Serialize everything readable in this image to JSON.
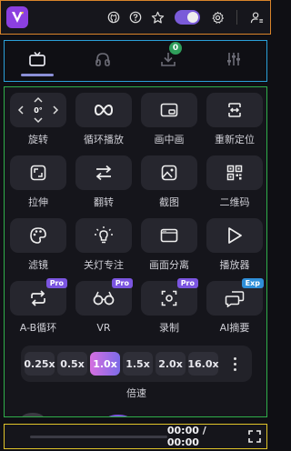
{
  "topbar": {
    "icons": [
      "logo-icon",
      "github-icon",
      "help-icon",
      "star-icon",
      "toggle",
      "gear-icon",
      "user-settings-icon"
    ],
    "toggle_on": true
  },
  "tabs": {
    "items": [
      {
        "name": "tv-icon",
        "active": true
      },
      {
        "name": "headphones-icon",
        "active": false
      },
      {
        "name": "download-icon",
        "active": false,
        "badge": "0"
      },
      {
        "name": "sliders-icon",
        "active": false
      }
    ]
  },
  "tools": {
    "rotate": {
      "label": "旋转",
      "value": "0°"
    },
    "loop": {
      "label": "循环播放"
    },
    "pip": {
      "label": "画中画"
    },
    "reposition": {
      "label": "重新定位"
    },
    "stretch": {
      "label": "拉伸"
    },
    "flip": {
      "label": "翻转"
    },
    "screenshot": {
      "label": "截图"
    },
    "qrcode": {
      "label": "二维码"
    },
    "filter": {
      "label": "滤镜"
    },
    "focus": {
      "label": "关灯专注"
    },
    "separate": {
      "label": "画面分离"
    },
    "player": {
      "label": "播放器"
    },
    "ab_loop": {
      "label": "A-B循环",
      "badge": "Pro"
    },
    "vr": {
      "label": "VR",
      "badge": "Pro"
    },
    "record": {
      "label": "录制",
      "badge": "Pro"
    },
    "ai_summary": {
      "label": "AI摘要",
      "badge": "Exp"
    }
  },
  "speed": {
    "label": "倍速",
    "options": [
      "0.25x",
      "0.5x",
      "1.0x",
      "1.5x",
      "2.0x",
      "16.0x"
    ],
    "selected": "1.0x"
  },
  "player": {
    "time": "00:00 / 00:00"
  },
  "colors": {
    "accent": "#8b3fe0",
    "pro_badge": "#7b55e0",
    "exp_badge": "#2f8fd9",
    "download_badge": "#2f9e5b"
  }
}
